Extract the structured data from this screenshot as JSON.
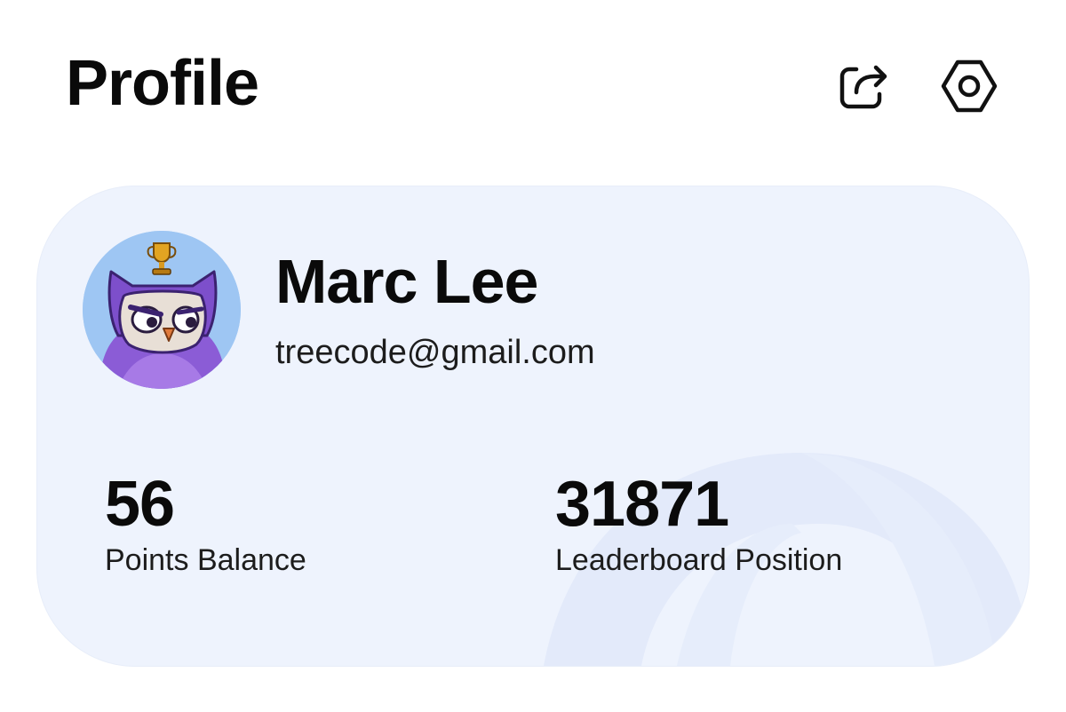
{
  "header": {
    "title": "Profile",
    "share_icon": "share-icon",
    "settings_icon": "settings-gear-icon"
  },
  "profile": {
    "name": "Marc Lee",
    "email": "treecode@gmail.com",
    "avatar_icon": "owl-avatar-with-trophy"
  },
  "stats": [
    {
      "value": "56",
      "label": "Points Balance"
    },
    {
      "value": "31871",
      "label": "Leaderboard Position"
    }
  ],
  "colors": {
    "card_background": "#eef3fd",
    "text": "#0a0a0a",
    "avatar_background": "#9ec6f3",
    "owl_purple": "#8b5cd6"
  }
}
